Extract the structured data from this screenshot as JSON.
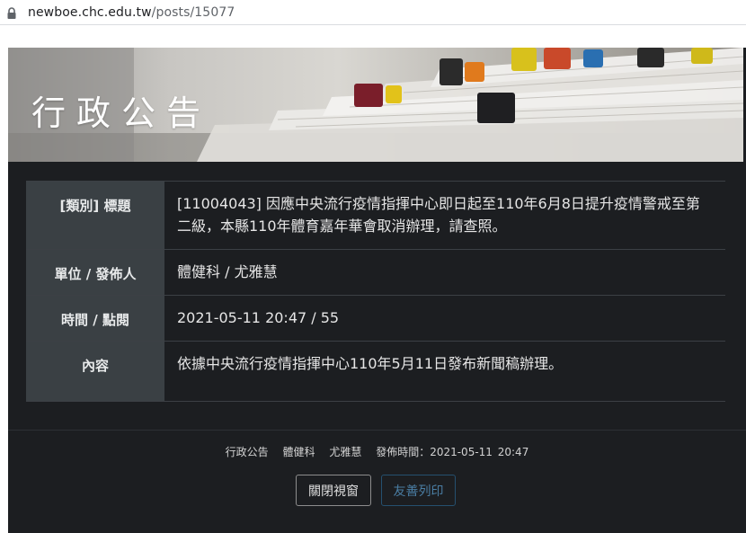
{
  "browser": {
    "url_host": "newboe.chc.edu.tw",
    "url_path": "/posts/15077"
  },
  "banner": {
    "title": "行政公告"
  },
  "post": {
    "rows": [
      {
        "label": "[類別] 標題",
        "value": "[11004043] 因應中央流行疫情指揮中心即日起至110年6月8日提升疫情警戒至第二級，本縣110年體育嘉年華會取消辦理，請查照。"
      },
      {
        "label": "單位 / 發佈人",
        "value": "體健科 / 尤雅慧"
      },
      {
        "label": "時間 / 點閱",
        "value": "2021-05-11 20:47 / 55"
      },
      {
        "label": "內容",
        "value": "依據中央流行疫情指揮中心110年5月11日發布新聞稿辦理。"
      }
    ]
  },
  "footer": {
    "category": "行政公告",
    "unit": "體健科",
    "author": "尤雅慧",
    "published": "發佈時間：2021-05-11 20:47"
  },
  "buttons": {
    "close": "關閉視窗",
    "print": "友善列印"
  },
  "colors": {
    "panel_bg": "#1c1e21",
    "header_cell_bg": "#3a4044",
    "print_button_text": "#4a7ea4"
  }
}
